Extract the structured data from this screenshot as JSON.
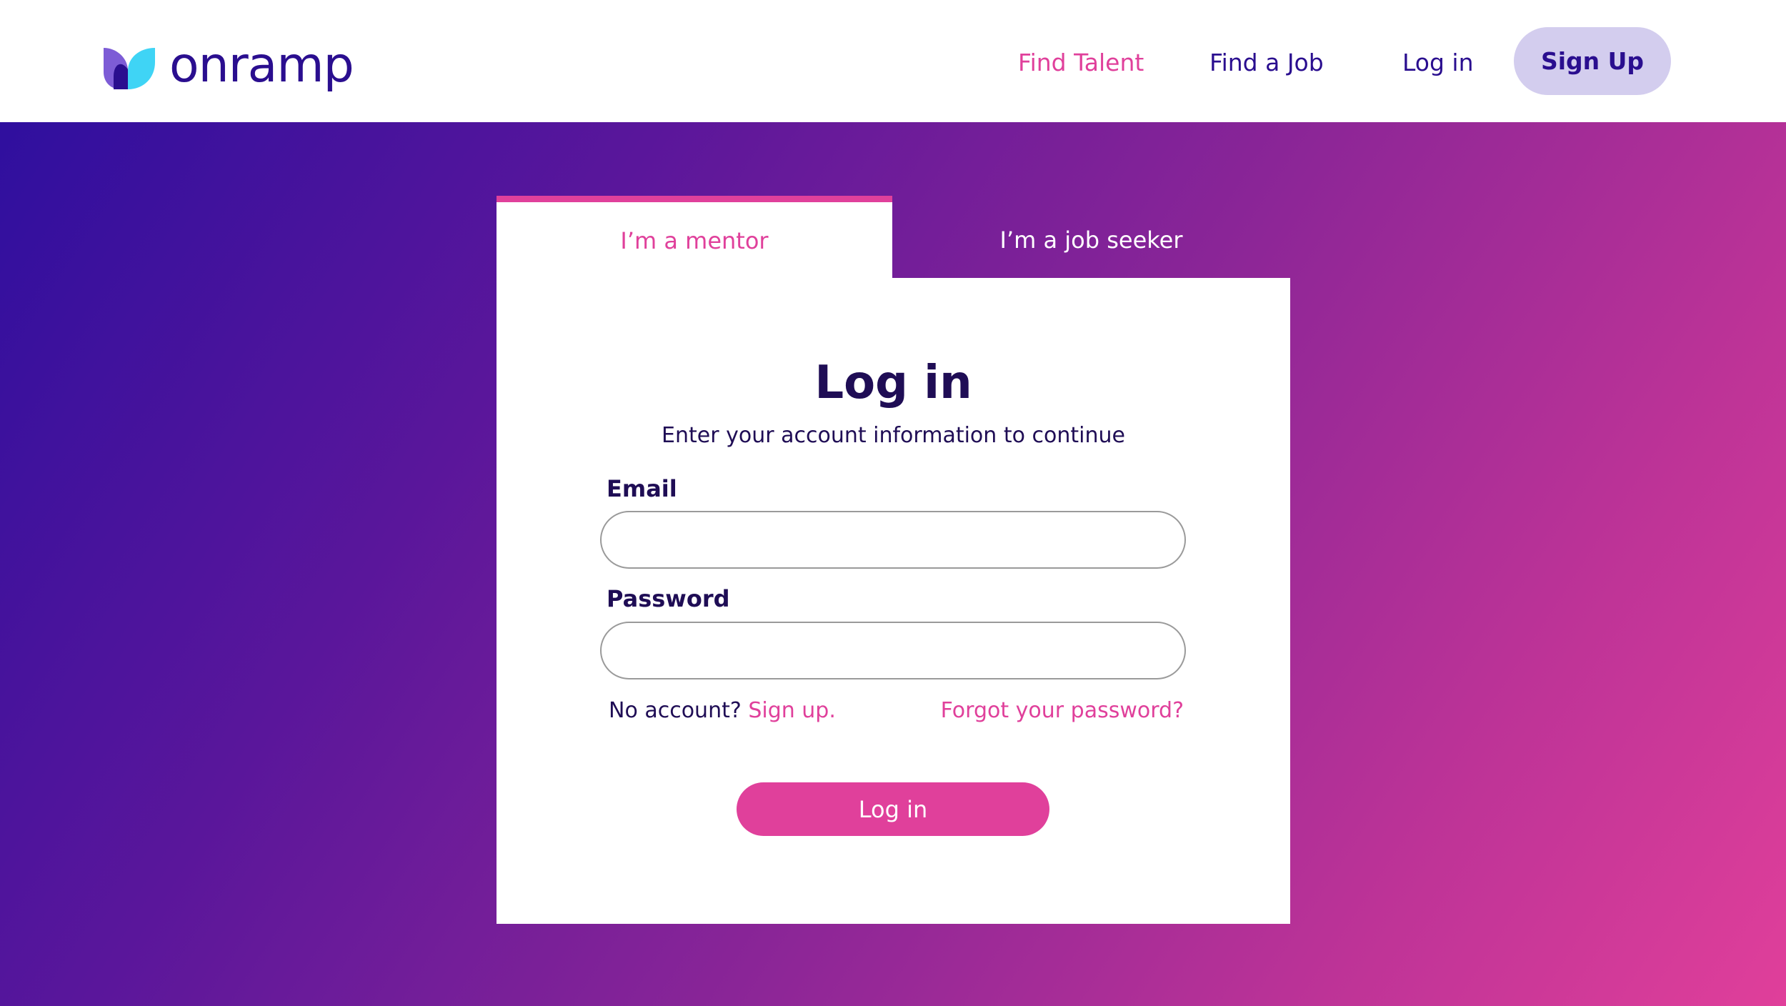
{
  "header": {
    "logo_text": "onramp",
    "nav": {
      "find_talent": "Find Talent",
      "find_job": "Find a Job",
      "login": "Log in",
      "signup": "Sign Up"
    }
  },
  "tabs": {
    "mentor": "I’m a mentor",
    "job_seeker": "I’m a job seeker"
  },
  "form": {
    "title": "Log in",
    "subtitle": "Enter your account information to continue",
    "email_label": "Email",
    "email_value": "",
    "password_label": "Password",
    "password_value": "",
    "no_account_text": "No account?",
    "signup_link": "Sign up.",
    "forgot_link": "Forgot your password?",
    "login_button": "Log in"
  },
  "colors": {
    "brand_dark": "#2a0e8f",
    "accent_pink": "#e0409b",
    "signup_bg": "#d3cdee",
    "gradient_start": "#2f0f9e",
    "gradient_end": "#e03f9a"
  },
  "icons": {
    "logo": "onramp-logo-icon"
  }
}
